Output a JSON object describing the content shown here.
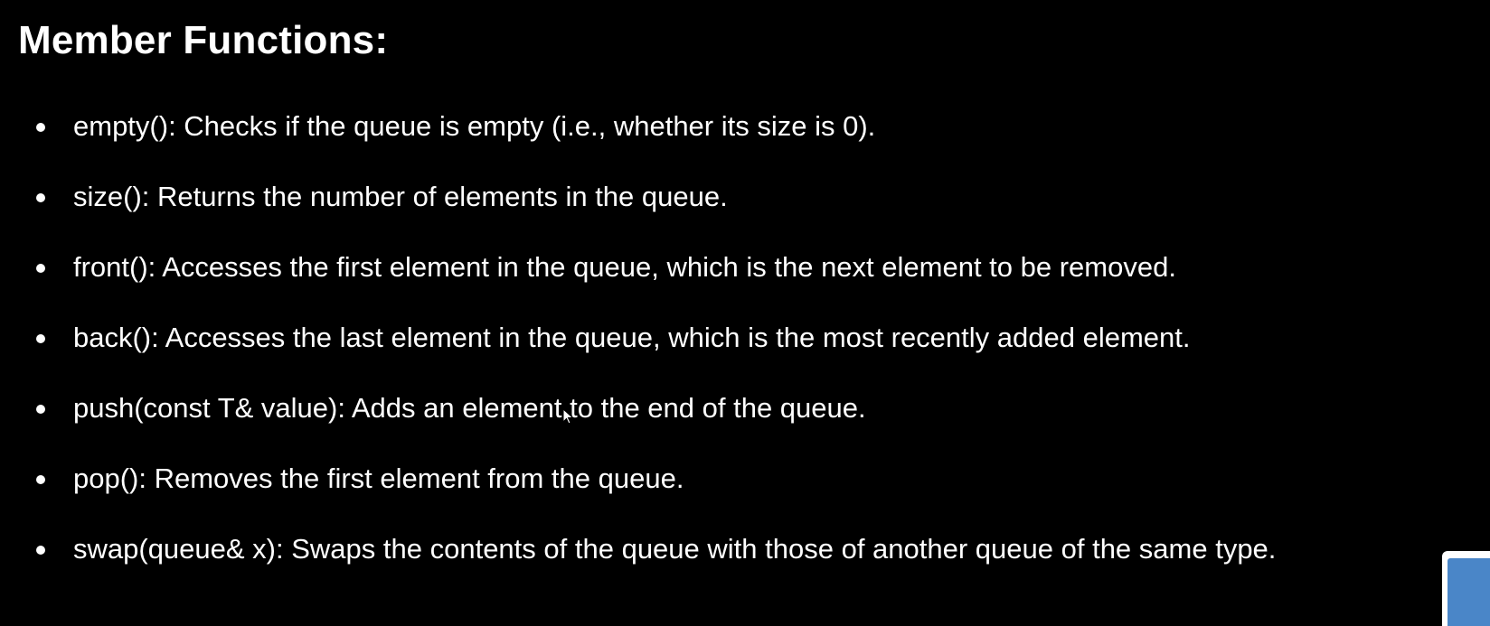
{
  "slide": {
    "title": "Member Functions:",
    "bullets": [
      "empty(): Checks if the queue is empty (i.e., whether its size is 0).",
      "size(): Returns the number of elements in the queue.",
      "front(): Accesses the first element in the queue, which is the next element to be removed.",
      "back(): Accesses the last element in the queue, which is the most recently added element.",
      "push(const T& value): Adds an element to the end of the queue.",
      "pop(): Removes the first element from the queue.",
      "swap(queue& x): Swaps the contents of the queue with those of another queue of the same type."
    ]
  },
  "colors": {
    "background": "#000000",
    "text": "#ffffff",
    "corner_widget_accent": "#4a86c8"
  },
  "icons": {
    "cursor": "mouse-cursor-icon"
  }
}
